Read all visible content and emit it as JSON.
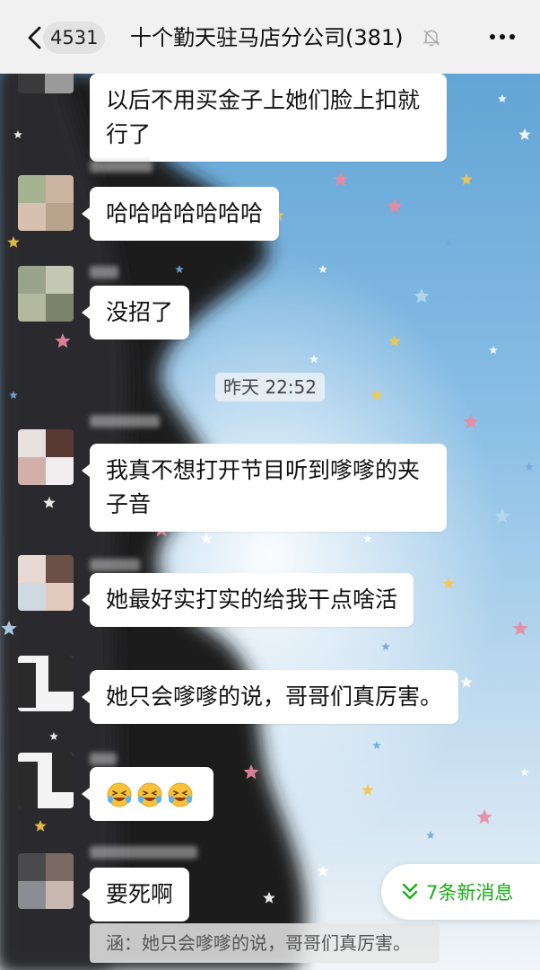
{
  "header": {
    "back_icon": "chevron-left-icon",
    "unread_count": "4531",
    "title": "十个勤天驻马店分公司(381)",
    "mute_icon": "bell-off-icon",
    "more_icon": "more-dots-icon"
  },
  "messages": [
    {
      "text": "以后不用买金子上她们脸上扣就行了"
    },
    {
      "text": "哈哈哈哈哈哈哈"
    },
    {
      "text": "没招了"
    },
    {
      "text": "我真不想打开节目听到嗲嗲的夹子音"
    },
    {
      "text": "她最好实打实的给我干点啥活"
    },
    {
      "text": "她只会嗲嗲的说，哥哥们真厉害。"
    },
    {
      "emoji": [
        "laughing-crying-emoji",
        "laughing-crying-emoji",
        "laughing-crying-emoji"
      ]
    },
    {
      "text": "要死啊"
    }
  ],
  "timestamp": "昨天 22:52",
  "new_messages": {
    "icon": "double-chevron-down-icon",
    "label": "7条新消息"
  },
  "quote_reply": "涵：她只会嗲嗲的说，哥哥们真厉害。",
  "colors": {
    "accent_green": "#1aad19",
    "header_bg": "#f1f1f1",
    "bubble_bg": "#ffffff"
  }
}
